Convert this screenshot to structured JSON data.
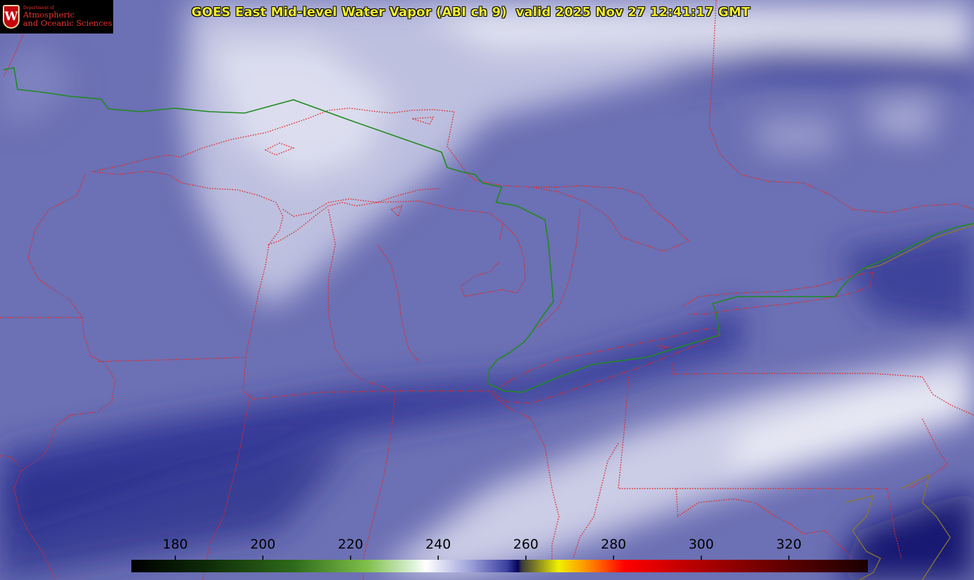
{
  "logo": {
    "department_small": "Department of",
    "line1": "Atmospheric",
    "line2": "and Oceanic Sciences",
    "shield_letter": "W"
  },
  "title": "GOES East Mid-level Water Vapor (ABI ch 9)  valid 2025 Nov 27 12:41:17 GMT",
  "colorbar": {
    "ticks": [
      "180",
      "200",
      "220",
      "240",
      "260",
      "280",
      "300",
      "320"
    ],
    "tick_values": [
      180,
      200,
      220,
      240,
      260,
      280,
      300,
      320
    ],
    "range": [
      170,
      338
    ]
  },
  "colors": {
    "state_border": "#e02828",
    "country_border": "#1f8a1f",
    "title_text": "#f2ee2c",
    "background_vapor": "#6f73b6",
    "dry_slot": "#1c1f8a",
    "clouds": "#e8e9f4"
  }
}
